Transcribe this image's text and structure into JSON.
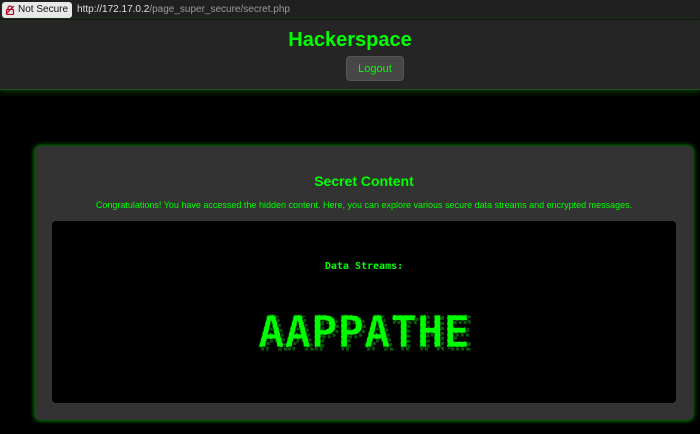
{
  "browser": {
    "security_label": "Not Secure",
    "security_icon": "lock-warning-icon",
    "url_host": "http://172.17.0.2",
    "url_path": "/page_super_secure/secret.php"
  },
  "header": {
    "title": "Hackerspace",
    "logout_label": "Logout"
  },
  "card": {
    "title": "Secret Content",
    "description": "Congratulations! You have accessed the hidden content. Here, you can explore various secure data streams and encrypted messages.",
    "streams_label": "Data Streams:",
    "banner_text": "AAPPATHE"
  },
  "colors": {
    "accent": "#00ff00",
    "background": "#000000",
    "card": "#333333",
    "header": "#252525"
  }
}
